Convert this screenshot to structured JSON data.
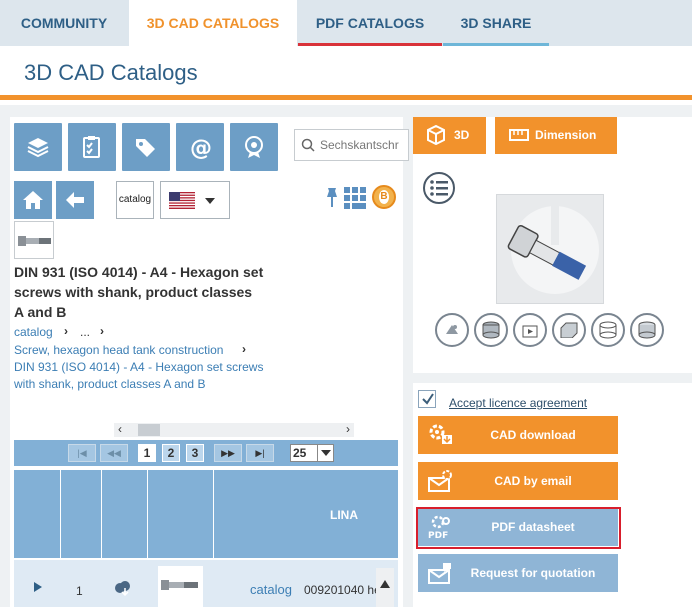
{
  "top_nav": {
    "tabs": [
      {
        "label": "COMMUNITY",
        "active": false
      },
      {
        "label": "3D CAD CATALOGS",
        "active": true
      },
      {
        "label": "PDF CATALOGS",
        "active": false
      },
      {
        "label": "3D SHARE",
        "active": false
      }
    ]
  },
  "page": {
    "title": "3D CAD Catalogs"
  },
  "toolbar": {
    "tools": [
      {
        "icon": "layers-icon"
      },
      {
        "icon": "clipboard-check-icon"
      },
      {
        "icon": "tags-icon"
      },
      {
        "icon": "at-sign-icon"
      },
      {
        "icon": "badge-icon"
      }
    ],
    "search_placeholder": "Sechskantschr"
  },
  "nav": {
    "catalog_logo": "catalog",
    "language_flag": "us-flag-icon",
    "badge": "B"
  },
  "part": {
    "title": "DIN 931 (ISO 4014) - A4 - Hexagon set screws with shank, product classes A and B",
    "breadcrumb": {
      "root": "catalog",
      "ellipsis": "...",
      "level1": "Screw, hexagon head tank construction",
      "level2": "DIN 931 (ISO 4014) - A4 - Hexagon set screws with shank, product classes A and B"
    }
  },
  "pager": {
    "first": "|◀",
    "prev": "◀◀",
    "pages": [
      "1",
      "2",
      "3"
    ],
    "current_page": "1",
    "next": "▶▶",
    "last": "▶|",
    "page_size": "25"
  },
  "grid": {
    "header_label": "LINA",
    "rows": [
      {
        "index": "1",
        "catalog": "catalog",
        "code": "009201040 he"
      }
    ]
  },
  "viewer": {
    "tab_3d": "3D",
    "tab_dimension": "Dimension"
  },
  "actions": {
    "licence_label": "Accept licence agreement",
    "licence_checked": true,
    "cad_download": "CAD download",
    "cad_email": "CAD by email",
    "pdf_datasheet": "PDF datasheet",
    "pdf_icon_text": "PDF",
    "request_quotation": "Request for quotation"
  },
  "colors": {
    "accent": "#f2922c",
    "nav_blue": "#6d9ec6",
    "highlight": "#d81e2c"
  }
}
